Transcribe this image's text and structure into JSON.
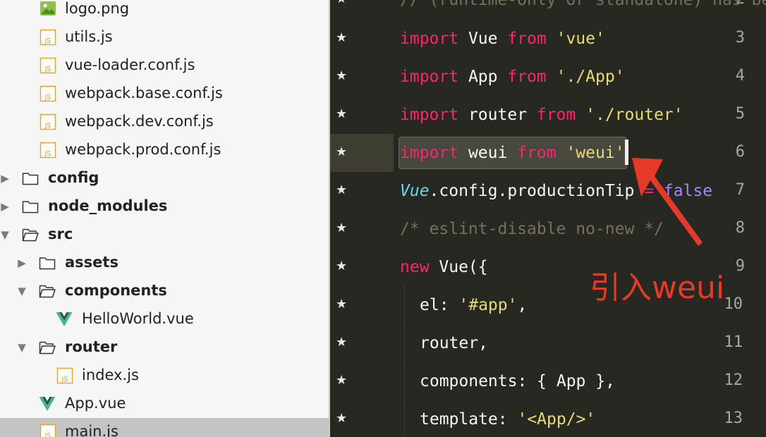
{
  "colors": {
    "sidebar_bg": "#f6f6f6",
    "selected_row": "#c4c4c4",
    "editor_bg": "#272822",
    "keyword": "#f92672",
    "string": "#e6db74",
    "annotation": "#e53a2a"
  },
  "sidebar": {
    "items": [
      {
        "label": "logo.png",
        "icon": "image-icon",
        "type": "file"
      },
      {
        "label": "utils.js",
        "icon": "js-file-icon",
        "type": "file"
      },
      {
        "label": "vue-loader.conf.js",
        "icon": "js-file-icon",
        "type": "file"
      },
      {
        "label": "webpack.base.conf.js",
        "icon": "js-file-icon",
        "type": "file"
      },
      {
        "label": "webpack.dev.conf.js",
        "icon": "js-file-icon",
        "type": "file"
      },
      {
        "label": "webpack.prod.conf.js",
        "icon": "js-file-icon",
        "type": "file"
      },
      {
        "label": "config",
        "icon": "folder-icon",
        "type": "folder",
        "state": "collapsed"
      },
      {
        "label": "node_modules",
        "icon": "folder-icon",
        "type": "folder",
        "state": "collapsed"
      },
      {
        "label": "src",
        "icon": "folder-open-icon",
        "type": "folder",
        "state": "expanded"
      },
      {
        "label": "assets",
        "icon": "folder-icon",
        "type": "folder",
        "state": "collapsed"
      },
      {
        "label": "components",
        "icon": "folder-open-icon",
        "type": "folder",
        "state": "expanded"
      },
      {
        "label": "HelloWorld.vue",
        "icon": "vue-file-icon",
        "type": "file"
      },
      {
        "label": "router",
        "icon": "folder-open-icon",
        "type": "folder",
        "state": "expanded"
      },
      {
        "label": "index.js",
        "icon": "js-file-icon",
        "type": "file"
      },
      {
        "label": "App.vue",
        "icon": "vue-file-icon",
        "type": "file"
      },
      {
        "label": "main.js",
        "icon": "js-file-icon",
        "type": "file",
        "selected": true
      }
    ]
  },
  "editor": {
    "star": "★",
    "top_partial": "// (runtime-only or standalone) has be",
    "lines": [
      {
        "number": "3",
        "text": "import Vue from 'vue'"
      },
      {
        "number": "4",
        "text": "import App from './App'"
      },
      {
        "number": "5",
        "text": "import router from './router'"
      },
      {
        "number": "6",
        "text": "import weui from 'weui'",
        "current": true
      },
      {
        "number": "7",
        "text": "Vue.config.productionTip = false"
      },
      {
        "number": "8",
        "text": "/* eslint-disable no-new */"
      },
      {
        "number": "9",
        "text": "new Vue({"
      },
      {
        "number": "10",
        "text": "el: '#app',"
      },
      {
        "number": "11",
        "text": "router,"
      },
      {
        "number": "12",
        "text": "components: { App },"
      },
      {
        "number": "13",
        "text": "template: '<App/>'"
      }
    ],
    "tokens": {
      "import": "import",
      "from": "from",
      "Vue": "Vue",
      "App": "App",
      "router": "router",
      "weui": "weui",
      "s_vue": "'vue'",
      "s_app": "'./App'",
      "s_router": "'./router'",
      "s_weui": "'weui'",
      "config_rest": ".config.productionTip",
      "eq": "=",
      "false": "false",
      "comment": "/* eslint-disable no-new */",
      "new": "new",
      "newvue_rest": " Vue({",
      "el": "el: ",
      "s_hash_app": "'#app'",
      "comma": ",",
      "router_comma": "router,",
      "components": "components: { App },",
      "template": "template: ",
      "s_template": "'<App/>'"
    }
  },
  "annotation": {
    "label": "引入weui"
  }
}
